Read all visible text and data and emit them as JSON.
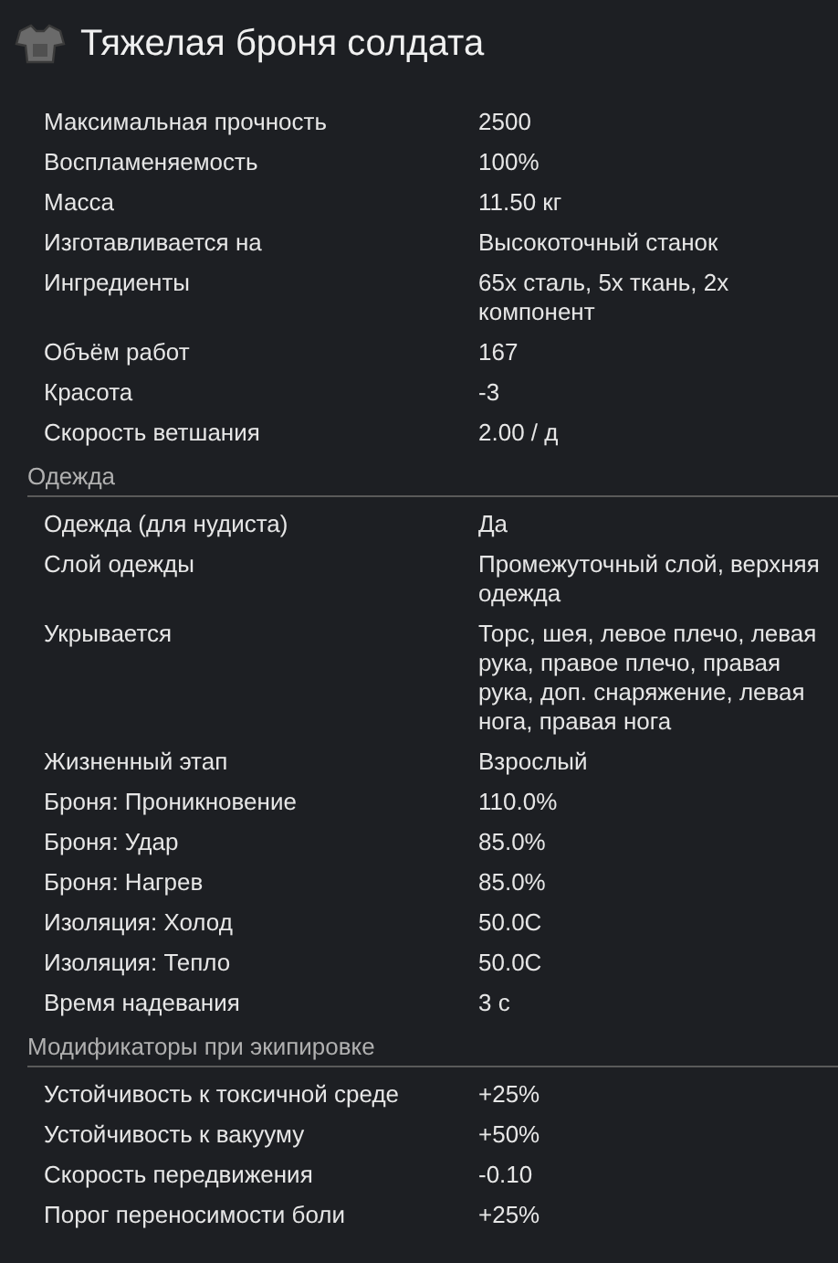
{
  "title": "Тяжелая броня солдата",
  "sections": [
    {
      "rows": [
        {
          "label": "Максимальная прочность",
          "value": "2500"
        },
        {
          "label": "Воспламеняемость",
          "value": "100%"
        },
        {
          "label": "Масса",
          "value": "11.50 кг"
        },
        {
          "label": "Изготавливается на",
          "value": "Высокоточный станок"
        },
        {
          "label": "Ингредиенты",
          "value": "65x сталь, 5x ткань, 2x компонент"
        },
        {
          "label": "Объём работ",
          "value": "167"
        },
        {
          "label": "Красота",
          "value": "-3"
        },
        {
          "label": "Скорость ветшания",
          "value": "2.00 / д"
        }
      ]
    },
    {
      "title": "Одежда",
      "rows": [
        {
          "label": "Одежда (для нудиста)",
          "value": "Да"
        },
        {
          "label": "Слой одежды",
          "value": "Промежуточный слой, верхняя одежда"
        },
        {
          "label": "Укрывается",
          "value": "Торс, шея, левое плечо, левая рука, правое плечо, правая рука, доп. снаряжение, левая нога, правая нога"
        },
        {
          "label": "Жизненный этап",
          "value": "Взрослый"
        },
        {
          "label": "Броня: Проникновение",
          "value": "110.0%"
        },
        {
          "label": "Броня: Удар",
          "value": "85.0%"
        },
        {
          "label": "Броня: Нагрев",
          "value": "85.0%"
        },
        {
          "label": "Изоляция: Холод",
          "value": "50.0C"
        },
        {
          "label": "Изоляция: Тепло",
          "value": "50.0C"
        },
        {
          "label": "Время надевания",
          "value": "3 с"
        }
      ]
    },
    {
      "title": "Модификаторы при экипировке",
      "rows": [
        {
          "label": "Устойчивость к токсичной среде",
          "value": "+25%"
        },
        {
          "label": "Устойчивость к вакууму",
          "value": "+50%"
        },
        {
          "label": "Скорость передвижения",
          "value": "-0.10"
        },
        {
          "label": "Порог переносимости боли",
          "value": "+25%"
        }
      ]
    }
  ]
}
